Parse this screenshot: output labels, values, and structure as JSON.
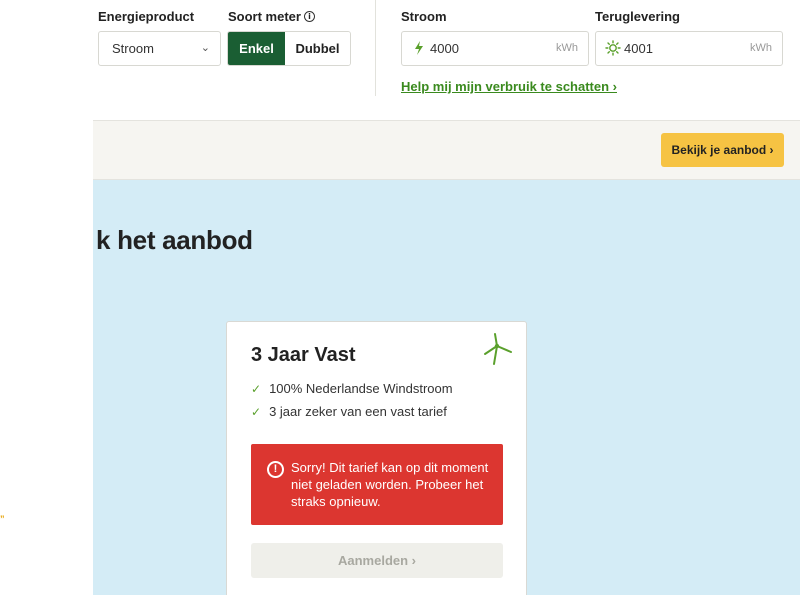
{
  "filters": {
    "energy_product": {
      "label": "Energieproduct",
      "value": "Stroom"
    },
    "meter_type": {
      "label": "Soort meter",
      "options": [
        "Enkel",
        "Dubbel"
      ],
      "selected": "Enkel"
    },
    "usage": {
      "label": "Stroom",
      "value": "4000",
      "unit": "kWh",
      "icon": "lightning-icon"
    },
    "return_supply": {
      "label": "Teruglevering",
      "value": "4001",
      "unit": "kWh",
      "icon": "sun-icon"
    },
    "help_link": "Help mij mijn verbruik te schatten ›"
  },
  "cta_bar": {
    "button": "Bekijk je aanbod ›",
    "accent": "#f6c343"
  },
  "offer_section": {
    "heading": "k het aanbod",
    "card": {
      "title": "3 Jaar Vast",
      "icon": "windmill-icon",
      "features": [
        "100% Nederlandse Windstroom",
        "3 jaar zeker van een vast tarief"
      ],
      "error_message": "Sorry! Dit tarief kan op dit moment niet geladen worden. Probeer het straks opnieuw.",
      "signup_button": "Aanmelden ›"
    }
  },
  "stray_mark": "”",
  "colors": {
    "primary_green": "#1a5e33",
    "link_green": "#3a8a1e",
    "error_red": "#dc3630",
    "section_blue": "#d4ecf6"
  }
}
